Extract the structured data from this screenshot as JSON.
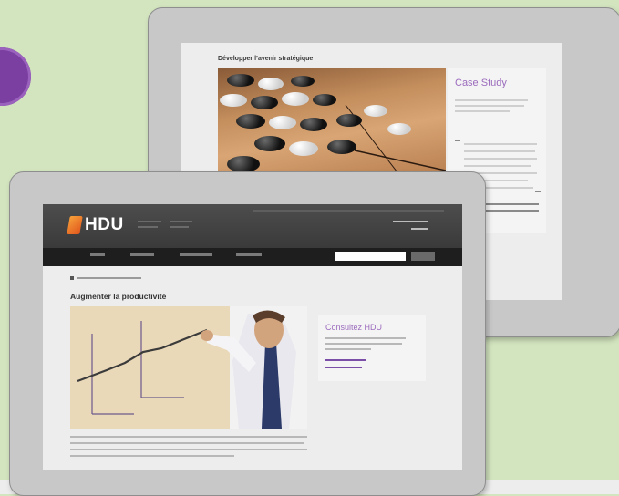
{
  "back_page": {
    "title": "Développer l’avenir stratégique",
    "side_card": {
      "title": "Case Study"
    }
  },
  "front_page": {
    "logo": "HDU",
    "page_title": "Augmenter la productivité",
    "card_title": "Consultez HDU"
  },
  "colors": {
    "background": "#d3e5bf",
    "accent_purple": "#9b6bbd",
    "badge_purple": "#7a3fa0",
    "header_dark": "#3a3a3a",
    "logo_orange": "#f7a13a"
  }
}
